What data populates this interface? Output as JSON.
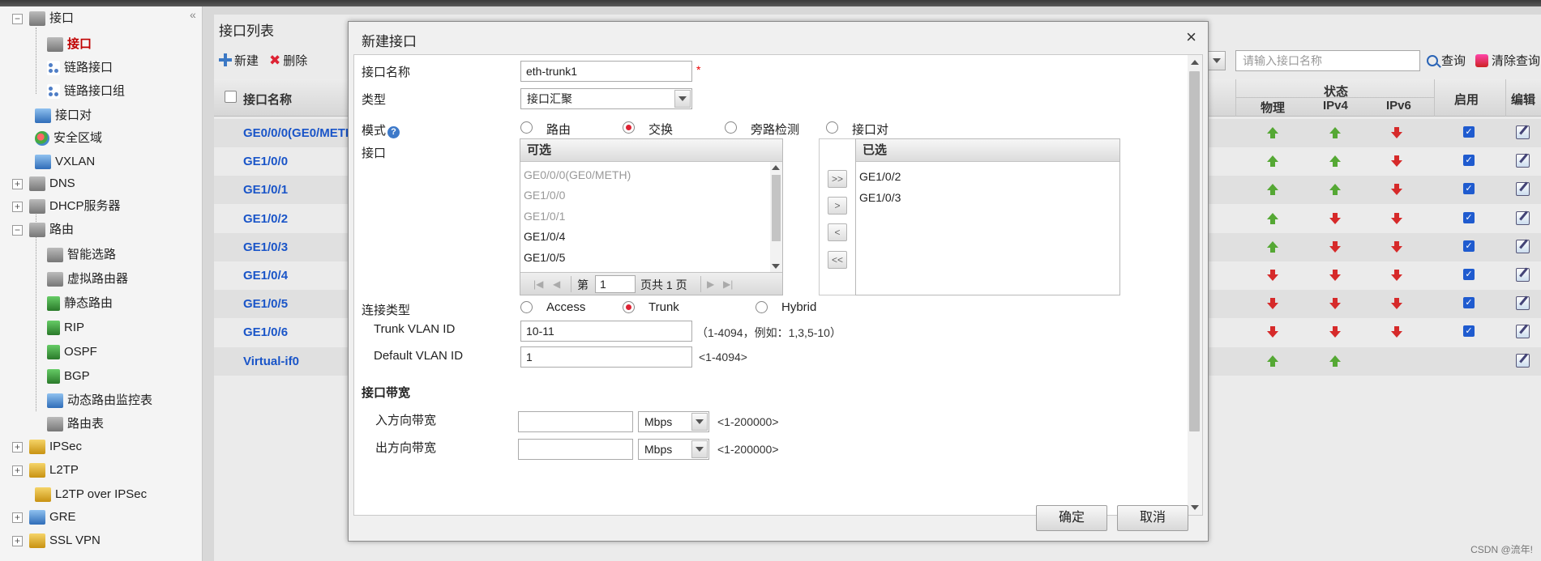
{
  "sidebar": {
    "items": [
      {
        "label": "接口",
        "toggle": "−",
        "icon": "interface-icon"
      },
      {
        "label": "接口",
        "icon": "interface-icon",
        "selected": true
      },
      {
        "label": "链路接口",
        "icon": "link-interface-icon"
      },
      {
        "label": "链路接口组",
        "icon": "link-group-icon"
      },
      {
        "label": "接口对",
        "icon": "interface-pair-icon"
      },
      {
        "label": "安全区域",
        "icon": "security-zone-icon"
      },
      {
        "label": "VXLAN",
        "icon": "vxlan-icon"
      },
      {
        "label": "DNS",
        "toggle": "+",
        "icon": "dns-icon"
      },
      {
        "label": "DHCP服务器",
        "toggle": "+",
        "icon": "dhcp-icon"
      },
      {
        "label": "路由",
        "toggle": "−",
        "icon": "route-icon"
      },
      {
        "label": "智能选路",
        "icon": "smart-route-icon"
      },
      {
        "label": "虚拟路由器",
        "icon": "virtual-router-icon"
      },
      {
        "label": "静态路由",
        "icon": "static-route-icon"
      },
      {
        "label": "RIP",
        "icon": "rip-icon"
      },
      {
        "label": "OSPF",
        "icon": "ospf-icon"
      },
      {
        "label": "BGP",
        "icon": "bgp-icon"
      },
      {
        "label": "动态路由监控表",
        "icon": "monitor-icon"
      },
      {
        "label": "路由表",
        "icon": "route-table-icon"
      },
      {
        "label": "IPSec",
        "toggle": "+",
        "icon": "ipsec-icon"
      },
      {
        "label": "L2TP",
        "toggle": "+",
        "icon": "l2tp-icon"
      },
      {
        "label": "L2TP over IPSec",
        "icon": "l2tp-ipsec-icon"
      },
      {
        "label": "GRE",
        "toggle": "+",
        "icon": "gre-icon"
      },
      {
        "label": "SSL VPN",
        "toggle": "+",
        "icon": "sslvpn-icon"
      }
    ]
  },
  "main": {
    "title": "接口列表",
    "new_label": "新建",
    "delete_label": "删除",
    "search_placeholder": "请输入接口名称",
    "query_label": "查询",
    "clear_label": "清除查询",
    "columns": {
      "name": "接口名称",
      "status": "状态",
      "physical": "物理",
      "ipv4": "IPv4",
      "ipv6": "IPv6",
      "enable": "启用",
      "edit": "编辑"
    },
    "rows": [
      {
        "name": "GE0/0/0(GE0/METH",
        "phys": "up",
        "ipv4": "up",
        "ipv6": "down",
        "enabled": true
      },
      {
        "name": "GE1/0/0",
        "phys": "up",
        "ipv4": "up",
        "ipv6": "down",
        "enabled": true
      },
      {
        "name": "GE1/0/1",
        "phys": "up",
        "ipv4": "up",
        "ipv6": "down",
        "enabled": true
      },
      {
        "name": "GE1/0/2",
        "phys": "up",
        "ipv4": "down",
        "ipv6": "down",
        "enabled": true
      },
      {
        "name": "GE1/0/3",
        "phys": "up",
        "ipv4": "down",
        "ipv6": "down",
        "enabled": true
      },
      {
        "name": "GE1/0/4",
        "phys": "down",
        "ipv4": "down",
        "ipv6": "down",
        "enabled": true
      },
      {
        "name": "GE1/0/5",
        "phys": "down",
        "ipv4": "down",
        "ipv6": "down",
        "enabled": true
      },
      {
        "name": "GE1/0/6",
        "phys": "down",
        "ipv4": "down",
        "ipv6": "down",
        "enabled": true
      },
      {
        "name": "Virtual-if0",
        "phys": "up",
        "ipv4": "up",
        "ipv6": "",
        "enabled": false
      }
    ]
  },
  "dialog": {
    "title": "新建接口",
    "close": "×",
    "name_label": "接口名称",
    "name_value": "eth-trunk1",
    "required_mark": "*",
    "type_label": "类型",
    "type_value": "接口汇聚",
    "mode_label": "模式",
    "help": "?",
    "modes": [
      "路由",
      "交换",
      "旁路检测",
      "接口对"
    ],
    "mode_selected": "交换",
    "iface_label": "接口",
    "available_header": "可选",
    "available": [
      {
        "name": "GE0/0/0(GE0/METH)",
        "disabled": true
      },
      {
        "name": "GE1/0/0",
        "disabled": true
      },
      {
        "name": "GE1/0/1",
        "disabled": true
      },
      {
        "name": "GE1/0/4",
        "disabled": false
      },
      {
        "name": "GE1/0/5",
        "disabled": false
      }
    ],
    "selected_header": "已选",
    "selected": [
      "GE1/0/2",
      "GE1/0/3"
    ],
    "pager": {
      "first": "|◀",
      "prev": "◀",
      "page_prefix": "第",
      "page_value": "1",
      "page_suffix": "页共 1 页",
      "next": "▶",
      "last": "▶|"
    },
    "move_buttons": [
      ">>",
      ">",
      "<",
      "<<"
    ],
    "link_type_label": "连接类型",
    "link_types": [
      "Access",
      "Trunk",
      "Hybrid"
    ],
    "link_type_selected": "Trunk",
    "trunk_vlan_label": "Trunk VLAN ID",
    "trunk_vlan_value": "10-11",
    "trunk_vlan_hint": "（1-4094，例如：1,3,5-10）",
    "default_vlan_label": "Default VLAN ID",
    "default_vlan_value": "1",
    "default_vlan_hint": "<1-4094>",
    "bandwidth_section": "接口带宽",
    "in_bw_label": "入方向带宽",
    "out_bw_label": "出方向带宽",
    "bw_unit": "Mbps",
    "bw_hint": "<1-200000>",
    "ok_label": "确定",
    "cancel_label": "取消"
  },
  "watermark": "CSDN @流年!"
}
